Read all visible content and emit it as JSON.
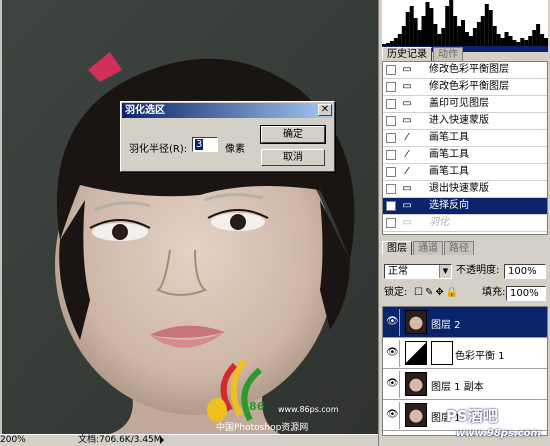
{
  "status": {
    "zoom": "200%",
    "doc": "文档:706.6K/3.45M"
  },
  "dialog": {
    "title": "羽化选区",
    "label": "羽化半径(R):",
    "value": "3",
    "unit": "像素",
    "ok": "确定",
    "cancel": "取消",
    "close": "✕"
  },
  "history": {
    "tabs": [
      "历史记录",
      "动作"
    ],
    "items": [
      {
        "label": "修改色彩平衡图层",
        "icon": "doc-icon",
        "state": "normal"
      },
      {
        "label": "修改色彩平衡图层",
        "icon": "doc-icon",
        "state": "normal"
      },
      {
        "label": "盖印可见图层",
        "icon": "doc-icon",
        "state": "normal"
      },
      {
        "label": "进入快速蒙版",
        "icon": "doc-icon",
        "state": "normal"
      },
      {
        "label": "画笔工具",
        "icon": "brush-icon",
        "state": "normal"
      },
      {
        "label": "画笔工具",
        "icon": "brush-icon",
        "state": "normal"
      },
      {
        "label": "画笔工具",
        "icon": "brush-icon",
        "state": "normal"
      },
      {
        "label": "退出快速蒙版",
        "icon": "doc-icon",
        "state": "normal"
      },
      {
        "label": "选择反向",
        "icon": "doc-icon",
        "state": "selected"
      },
      {
        "label": "羽化",
        "icon": "doc-icon",
        "state": "dim"
      }
    ]
  },
  "layers": {
    "tabs": [
      "图层",
      "通道",
      "路径"
    ],
    "blend_mode": "正常",
    "opacity_label": "不透明度:",
    "opacity": "100%",
    "lock_label": "锁定:",
    "fill_label": "填充:",
    "fill": "100%",
    "items": [
      {
        "name": "图层 2",
        "selected": true,
        "thumb": "face"
      },
      {
        "name": "色彩平衡 1",
        "selected": false,
        "thumb": "adjust"
      },
      {
        "name": "图层 1 副本",
        "selected": false,
        "thumb": "face"
      },
      {
        "name": "图层 1",
        "selected": false,
        "thumb": "face"
      }
    ]
  },
  "watermarks": {
    "logo_text": "86",
    "site": "www.86ps.com",
    "site_cn": "中国Photoshop资源网",
    "ps_logo": "PS酒吧",
    "ps_url": "www.98ps.com"
  },
  "colors": {
    "selection": "#0a246a",
    "face_bg": "#3a3f3c"
  }
}
